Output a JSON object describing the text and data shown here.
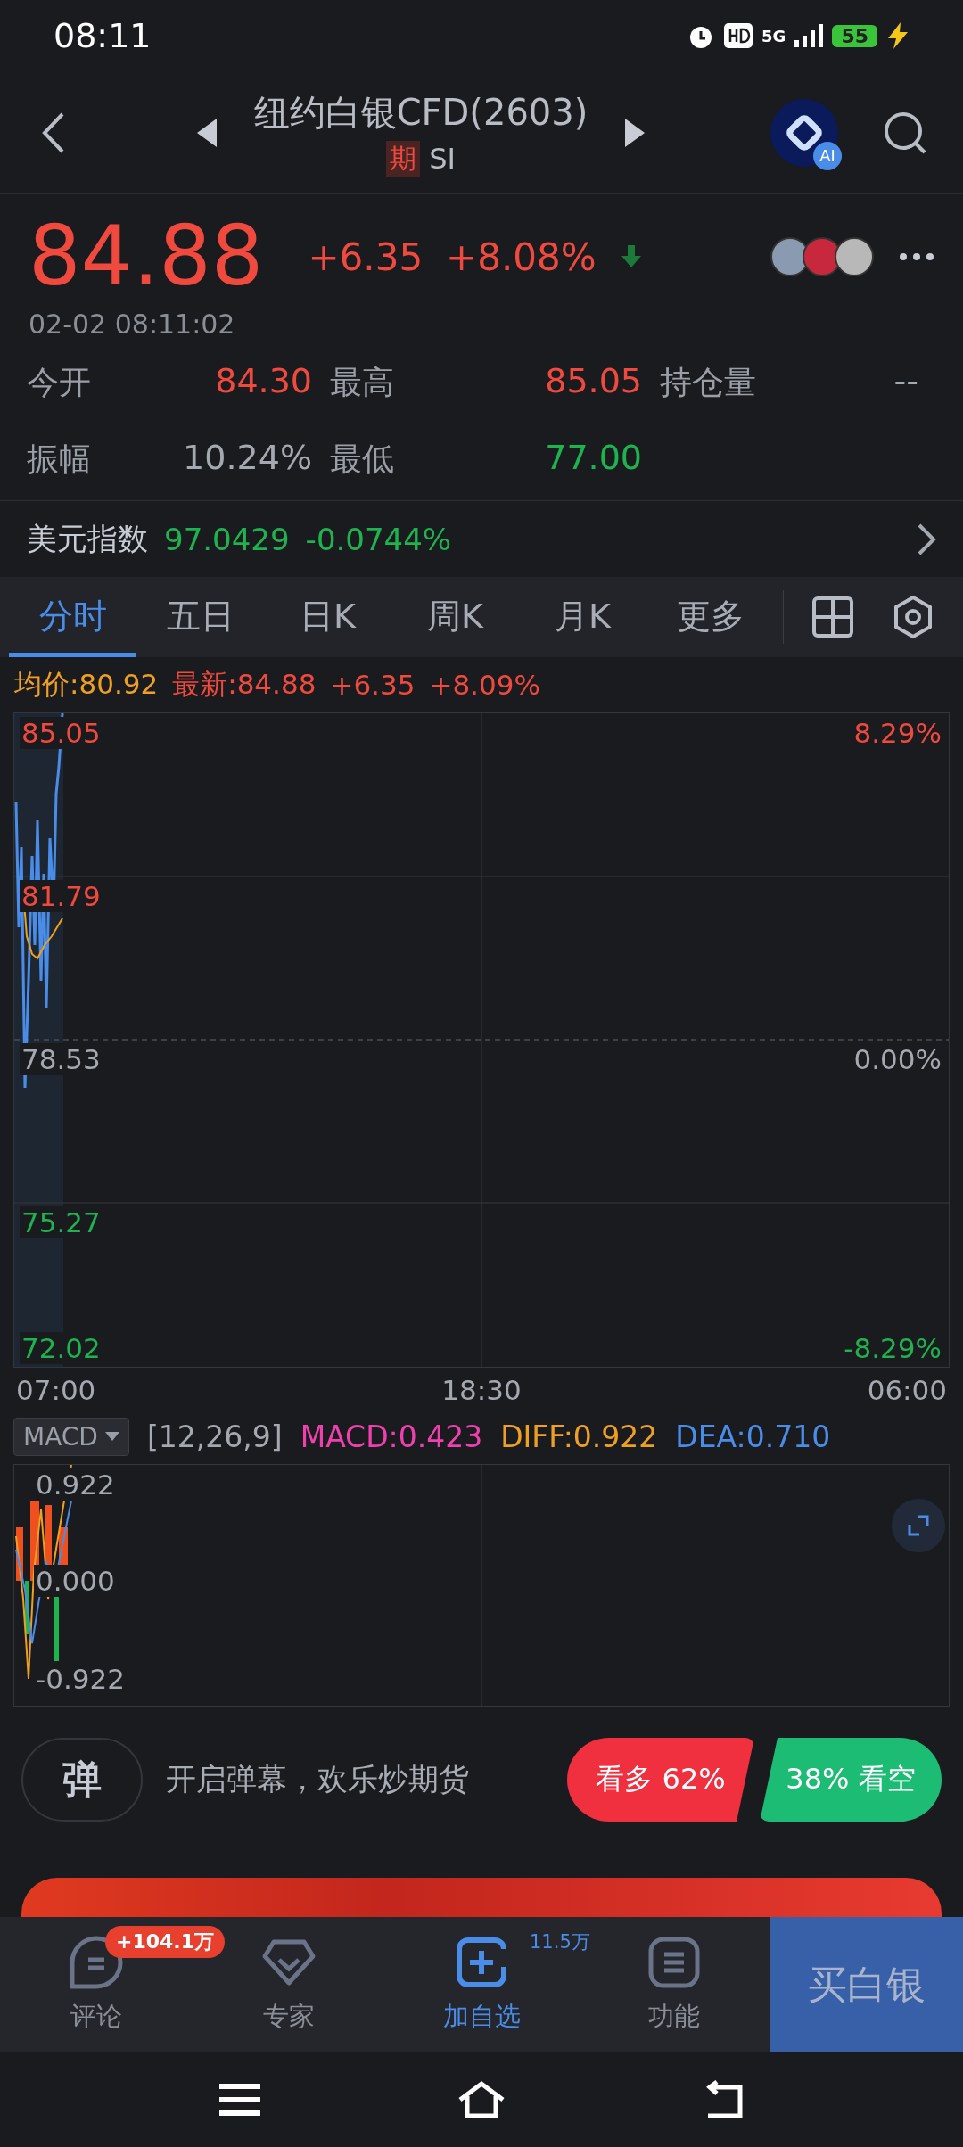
{
  "status_bar": {
    "time": "08:11",
    "network": "5G",
    "battery": "55"
  },
  "header": {
    "title": "纽约白银CFD(2603)",
    "tag": "期",
    "code": "SI",
    "ai_badge": "AI"
  },
  "quote": {
    "price": "84.88",
    "change": "+6.35",
    "change_pct": "+8.08%",
    "time": "02-02 08:11:02"
  },
  "stats": [
    {
      "label": "今开",
      "value": "84.30",
      "color": "#f04a3e"
    },
    {
      "label": "最高",
      "value": "85.05",
      "color": "#f04a3e"
    },
    {
      "label": "持仓量",
      "value": "--",
      "color": "#a4a8b0"
    },
    {
      "label": "振幅",
      "value": "10.24%",
      "color": "#a4a8b0"
    },
    {
      "label": "最低",
      "value": "77.00",
      "color": "#1db34f"
    }
  ],
  "index_row": {
    "label": "美元指数",
    "value": "97.0429",
    "change": "-0.0744%"
  },
  "tabs": [
    {
      "label": "分时",
      "selected": true
    },
    {
      "label": "五日",
      "selected": false
    },
    {
      "label": "日K",
      "selected": false
    },
    {
      "label": "周K",
      "selected": false
    },
    {
      "label": "月K",
      "selected": false
    },
    {
      "label": "更多",
      "selected": false
    }
  ],
  "chart_info": {
    "avg": "均价:80.92",
    "latest": "最新:84.88",
    "change": "+6.35",
    "pct": "+8.09%"
  },
  "y_labels": [
    {
      "value": "85.05",
      "pct": "8.29%",
      "color": "#f04a3e"
    },
    {
      "value": "81.79",
      "color": "#f04a3e"
    },
    {
      "value": "78.53",
      "pct": "0.00%",
      "color": "#a4a8b0"
    },
    {
      "value": "75.27",
      "color": "#1db34f"
    },
    {
      "value": "72.02",
      "pct": "-8.29%",
      "color": "#1db34f"
    }
  ],
  "time_axis": [
    "07:00",
    "18:30",
    "06:00"
  ],
  "macd": {
    "selector": "MACD",
    "params": "[12,26,9]",
    "values": [
      {
        "kind": "macd",
        "text": "MACD:0.423"
      },
      {
        "kind": "diff",
        "text": "DIFF:0.922"
      },
      {
        "kind": "dea",
        "text": "DEA:0.710"
      }
    ],
    "y_labels": [
      "0.922",
      "0.000",
      "-0.922"
    ]
  },
  "danmu": {
    "icon_char": "弹",
    "text": "开启弹幕，欢乐炒期货"
  },
  "sentiment": {
    "bull": "看多 62%",
    "bear": "38% 看空"
  },
  "bottom_nav": [
    {
      "kind": "chat",
      "label": "评论",
      "badge": "+104.1万",
      "selected": false
    },
    {
      "kind": "expert",
      "label": "专家",
      "selected": false
    },
    {
      "kind": "add",
      "label": "加自选",
      "count": "11.5万",
      "selected": true
    },
    {
      "kind": "menu",
      "label": "功能",
      "selected": false
    }
  ],
  "buy_button": "买白银"
}
